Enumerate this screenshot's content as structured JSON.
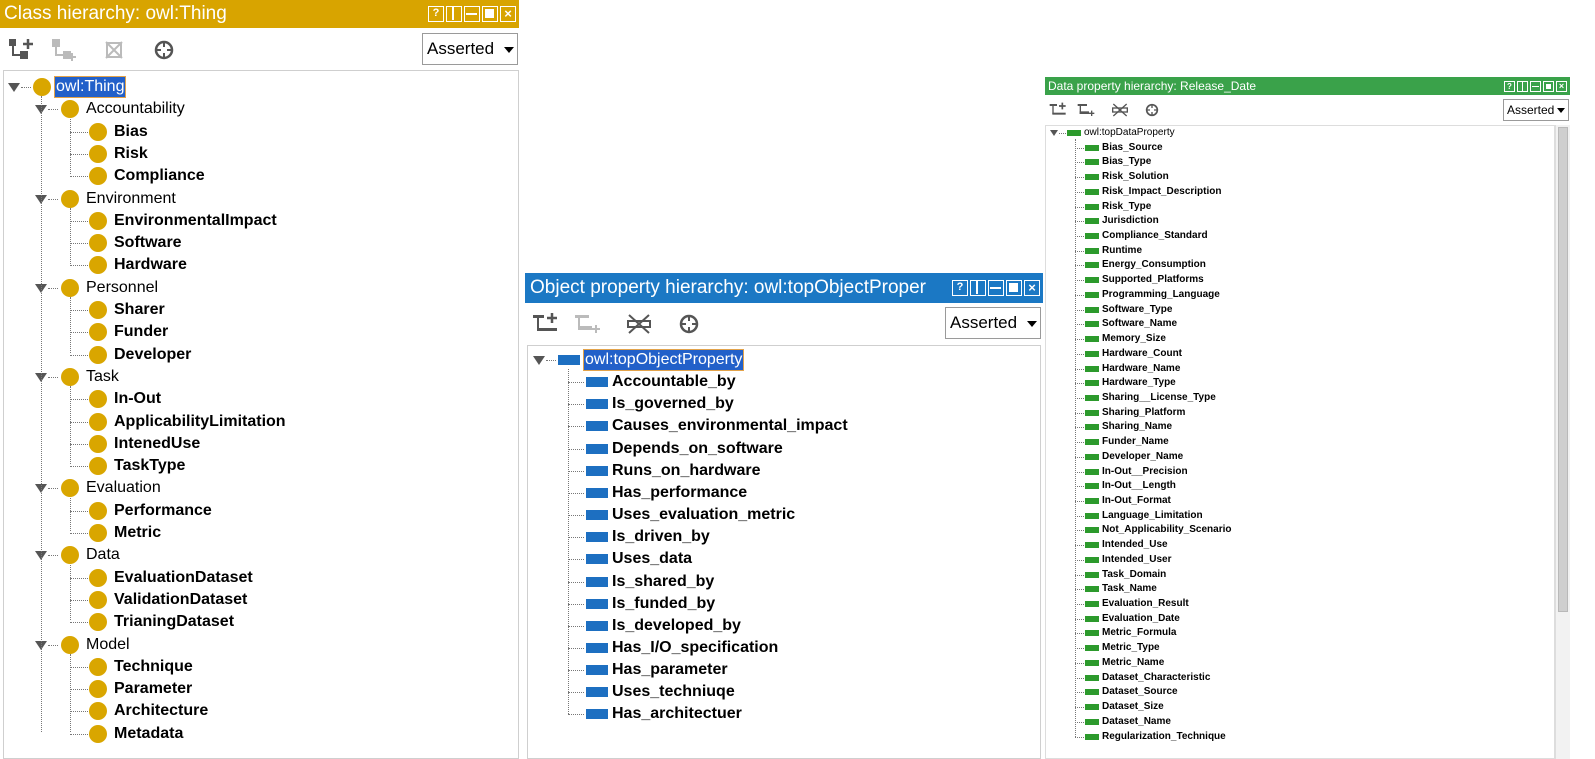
{
  "class_panel": {
    "title": "Class hierarchy: owl:Thing",
    "title_color": "#d8a400",
    "mode": "Asserted",
    "toolbar_icons": [
      "add-subclass-icon",
      "add-sibling-class-icon",
      "delete-class-icon",
      "find-icon"
    ],
    "root": "owl:Thing",
    "groups": [
      {
        "label": "Accountability",
        "children": [
          "Bias",
          "Risk",
          "Compliance"
        ]
      },
      {
        "label": "Environment",
        "children": [
          "EnvironmentalImpact",
          "Software",
          "Hardware"
        ]
      },
      {
        "label": "Personnel",
        "children": [
          "Sharer",
          "Funder",
          "Developer"
        ]
      },
      {
        "label": "Task",
        "children": [
          "In-Out",
          "ApplicabilityLimitation",
          "IntenedUse",
          "TaskType"
        ]
      },
      {
        "label": "Evaluation",
        "children": [
          "Performance",
          "Metric"
        ]
      },
      {
        "label": "Data",
        "children": [
          "EvaluationDataset",
          "ValidationDataset",
          "TrianingDataset"
        ]
      },
      {
        "label": "Model",
        "children": [
          "Technique",
          "Parameter",
          "Architecture",
          "Metadata"
        ]
      }
    ]
  },
  "object_panel": {
    "title": "Object property hierarchy: owl:topObjectProper",
    "title_color": "#1b78c4",
    "mode": "Asserted",
    "toolbar_icons": [
      "add-subproperty-icon",
      "add-sibling-property-icon",
      "delete-property-icon",
      "find-icon"
    ],
    "root": "owl:topObjectProperty",
    "children": [
      "Accountable_by",
      "Is_governed_by",
      "Causes_environmental_impact",
      "Depends_on_software",
      "Runs_on_hardware",
      "Has_performance",
      "Uses_evaluation_metric",
      "Is_driven_by",
      "Uses_data",
      "Is_shared_by",
      "Is_funded_by",
      "Is_developed_by",
      "Has_I/O_specification",
      "Has_parameter",
      "Uses_techniuqe",
      "Has_architectuer"
    ]
  },
  "data_panel": {
    "title": "Data property hierarchy: Release_Date",
    "title_color": "#3aa24a",
    "mode": "Asserted",
    "toolbar_icons": [
      "add-subproperty-icon",
      "add-sibling-property-icon",
      "delete-property-icon",
      "find-icon"
    ],
    "root": "owl:topDataProperty",
    "children": [
      "Bias_Source",
      "Bias_Type",
      "Risk_Solution",
      "Risk_Impact_Description",
      "Risk_Type",
      "Jurisdiction",
      "Compliance_Standard",
      "Runtime",
      "Energy_Consumption",
      "Supported_Platforms",
      "Programming_Language",
      "Software_Type",
      "Software_Name",
      "Memory_Size",
      "Hardware_Count",
      "Hardware_Name",
      "Hardware_Type",
      "Sharing__License_Type",
      "Sharing_Platform",
      "Sharing_Name",
      "Funder_Name",
      "Developer_Name",
      "In-Out__Precision",
      "In-Out__Length",
      "In-Out_Format",
      "Language_Limitation",
      "Not_Applicability_Scenario",
      "Intended_Use",
      "Intended_User",
      "Task_Domain",
      "Task_Name",
      "Evaluation_Result",
      "Evaluation_Date",
      "Metric_Formula",
      "Metric_Type",
      "Metric_Name",
      "Dataset_Characteristic",
      "Dataset_Source",
      "Dataset_Size",
      "Dataset_Name",
      "Regularization_Technique"
    ]
  }
}
